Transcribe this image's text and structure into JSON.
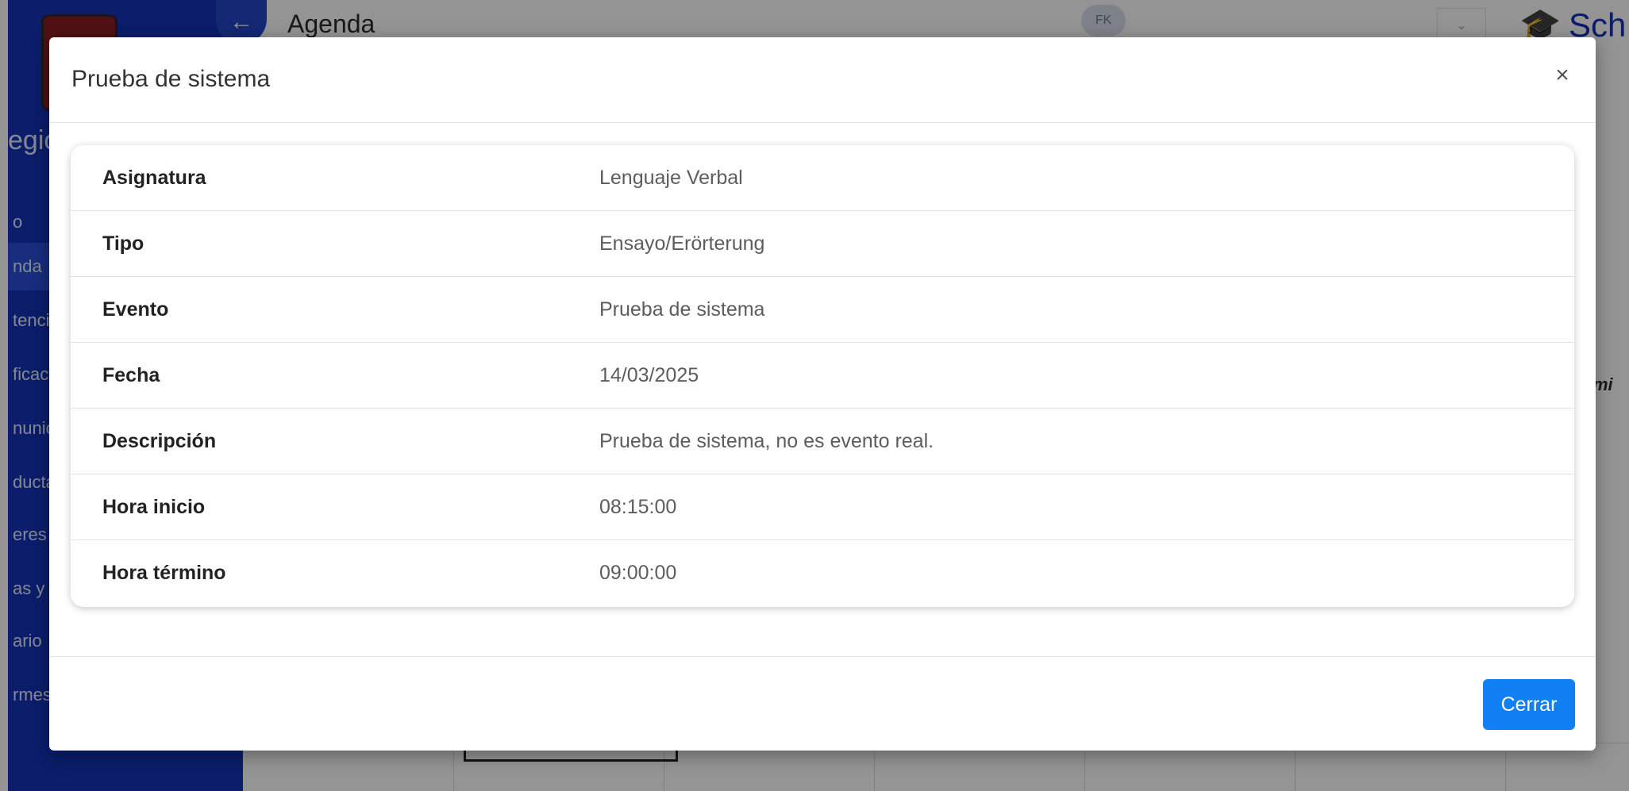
{
  "background": {
    "page_title": "Agenda",
    "avatar_initials": "FK",
    "app_name": "Sch",
    "sidebar_brand": "egio",
    "sidebar_items": [
      "o",
      "nda",
      "tenci",
      "ficac",
      "nunic",
      "ducta",
      "eres I",
      "as y M",
      "ario",
      "rmes"
    ],
    "active_index": 1,
    "right_header_fragment": "mi"
  },
  "modal": {
    "title": "Prueba de sistema",
    "close_symbol": "×",
    "rows": [
      {
        "label": "Asignatura",
        "value": "Lenguaje Verbal"
      },
      {
        "label": "Tipo",
        "value": "Ensayo/Erörterung"
      },
      {
        "label": "Evento",
        "value": "Prueba de sistema"
      },
      {
        "label": "Fecha",
        "value": "14/03/2025"
      },
      {
        "label": "Descripción",
        "value": "Prueba de sistema, no es evento real."
      },
      {
        "label": "Hora inicio",
        "value": "08:15:00"
      },
      {
        "label": "Hora término",
        "value": "09:00:00"
      }
    ],
    "close_button_label": "Cerrar"
  },
  "colors": {
    "primary_button": "#1180f5",
    "sidebar": "#1433b8"
  }
}
